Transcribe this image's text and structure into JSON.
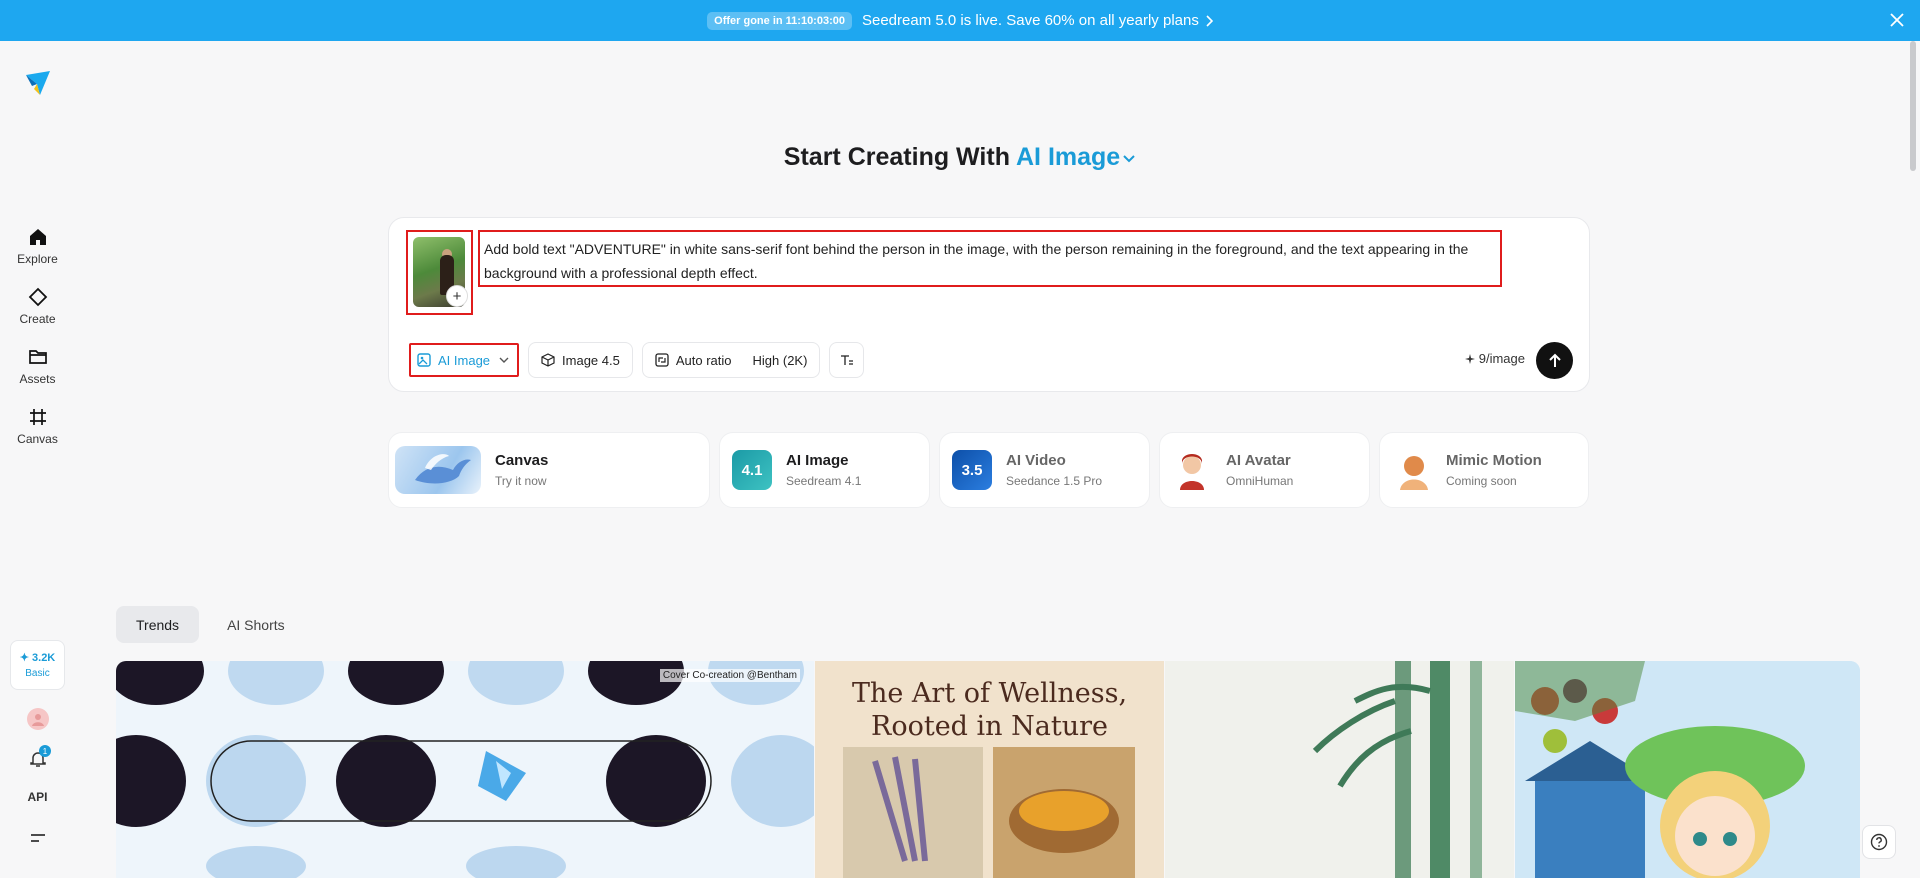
{
  "banner": {
    "offer": "Offer gone in 11:10:03:00",
    "message": "Seedream 5.0 is live. Save 60% on all yearly plans"
  },
  "sidebar": {
    "items": [
      {
        "label": "Explore",
        "icon": "home-icon"
      },
      {
        "label": "Create",
        "icon": "diamond-icon"
      },
      {
        "label": "Assets",
        "icon": "folder-icon"
      },
      {
        "label": "Canvas",
        "icon": "canvas-icon"
      }
    ],
    "credits": "3.2K",
    "plan": "Basic",
    "notifications": "1",
    "api": "API"
  },
  "heading": {
    "prefix": "Start Creating With",
    "accent": "AI Image"
  },
  "prompt": {
    "text": "Add bold text \"ADVENTURE\" in white sans-serif font behind the person in the image, with the person remaining in the foreground, and the text appearing in the background with a professional depth effect.",
    "add_symbol": "+"
  },
  "toolbar": {
    "mode": "AI Image",
    "model": "Image 4.5",
    "ratio": "Auto ratio",
    "quality": "High (2K)",
    "cost": "9/image"
  },
  "features": [
    {
      "name": "Canvas",
      "sub": "Try it now",
      "icon": "pegasus-icon"
    },
    {
      "name": "AI Image",
      "sub": "Seedream 4.1",
      "icon": "seedream-icon",
      "badge": "4.1"
    },
    {
      "name": "AI Video",
      "sub": "Seedance 1.5 Pro",
      "icon": "seedance-icon",
      "badge": "3.5"
    },
    {
      "name": "AI Avatar",
      "sub": "OmniHuman",
      "icon": "avatar-icon"
    },
    {
      "name": "Mimic Motion",
      "sub": "Coming soon",
      "icon": "motion-icon"
    }
  ],
  "tabs": [
    {
      "label": "Trends",
      "active": true
    },
    {
      "label": "AI Shorts",
      "active": false
    }
  ],
  "gallery": {
    "credit": "Cover Co-creation @Bentham",
    "wellness_title": "The Art of Wellness, Rooted in Nature"
  },
  "colors": {
    "banner": "#1ea7f0",
    "accent": "#1a9bd7",
    "highlight": "#e01c1c"
  }
}
